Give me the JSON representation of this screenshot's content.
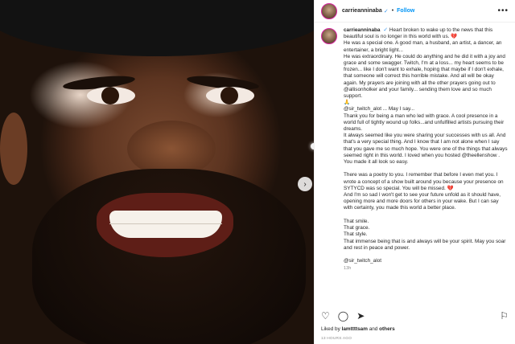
{
  "post": {
    "username": "carrieanninaba",
    "follow_label": "Follow",
    "more_label": "•••",
    "caption_user": "carrieanninaba",
    "verified": "✓",
    "caption": "Heart broken to wake up to the news that this beautiful soul is no longer in this world with us. 💔\nHe was a special one. A good man, a husband, an artist, a dancer, an entertainer, a bright light...\nHe was extraordinary. He could do anything and he did it with a joy and grace and some swagger. Twitch, I'm at a loss... my heart seems to be frozen... like I don't want to exhale, hoping that maybe if I don't exhale, that someone will correct this horrible mistake. And all will be okay again. My prayers are joining with all the other prayers going out to @allisonholker and your family... sending them love and so much support.\n🙏\n@sir_twitch_alot ... May I say...\nThank you for being a man who led with grace. A cool presence in a world full of tightly wound up folks...and unfulfilled artists pursuing their dreams.\nIt always seemed like you were sharing your successes with us all. And that's a very special thing. And I know that I am not alone when I say that you gave me so much hope. You were one of the things that always seemed right in this world. I loved when you hosted @theellenshow . You made it all look so easy.\n\nThere was a poetry to you. I remember that before I even met you. I wrote a concept of a show built around you because your presence on SYTYCD was so special. You will be missed. 💔\nAnd I'm so sad I won't get to see your future unfold as it should have, opening more and more doors for others in your wake. But I can say with certainty, you made this world a better place.\n\nThat smile.\nThat grace.\nThat style.\nThat immense being that is and always will be your spirit. May you soar and rest in peace and power.\n\n@sir_twitch_alot",
    "time_ago": "13h",
    "liked_by_prefix": "Liked by ",
    "liked_by_user": "lamttttsam",
    "liked_by_and": " and ",
    "liked_by_others": "others",
    "posted_time": "13 HOURS AGO"
  },
  "photo": {
    "next_icon": "›"
  },
  "actions": {
    "like_icon": "♡",
    "comment_icon": "◯",
    "share_icon": "➤",
    "save_icon": "⚐"
  }
}
